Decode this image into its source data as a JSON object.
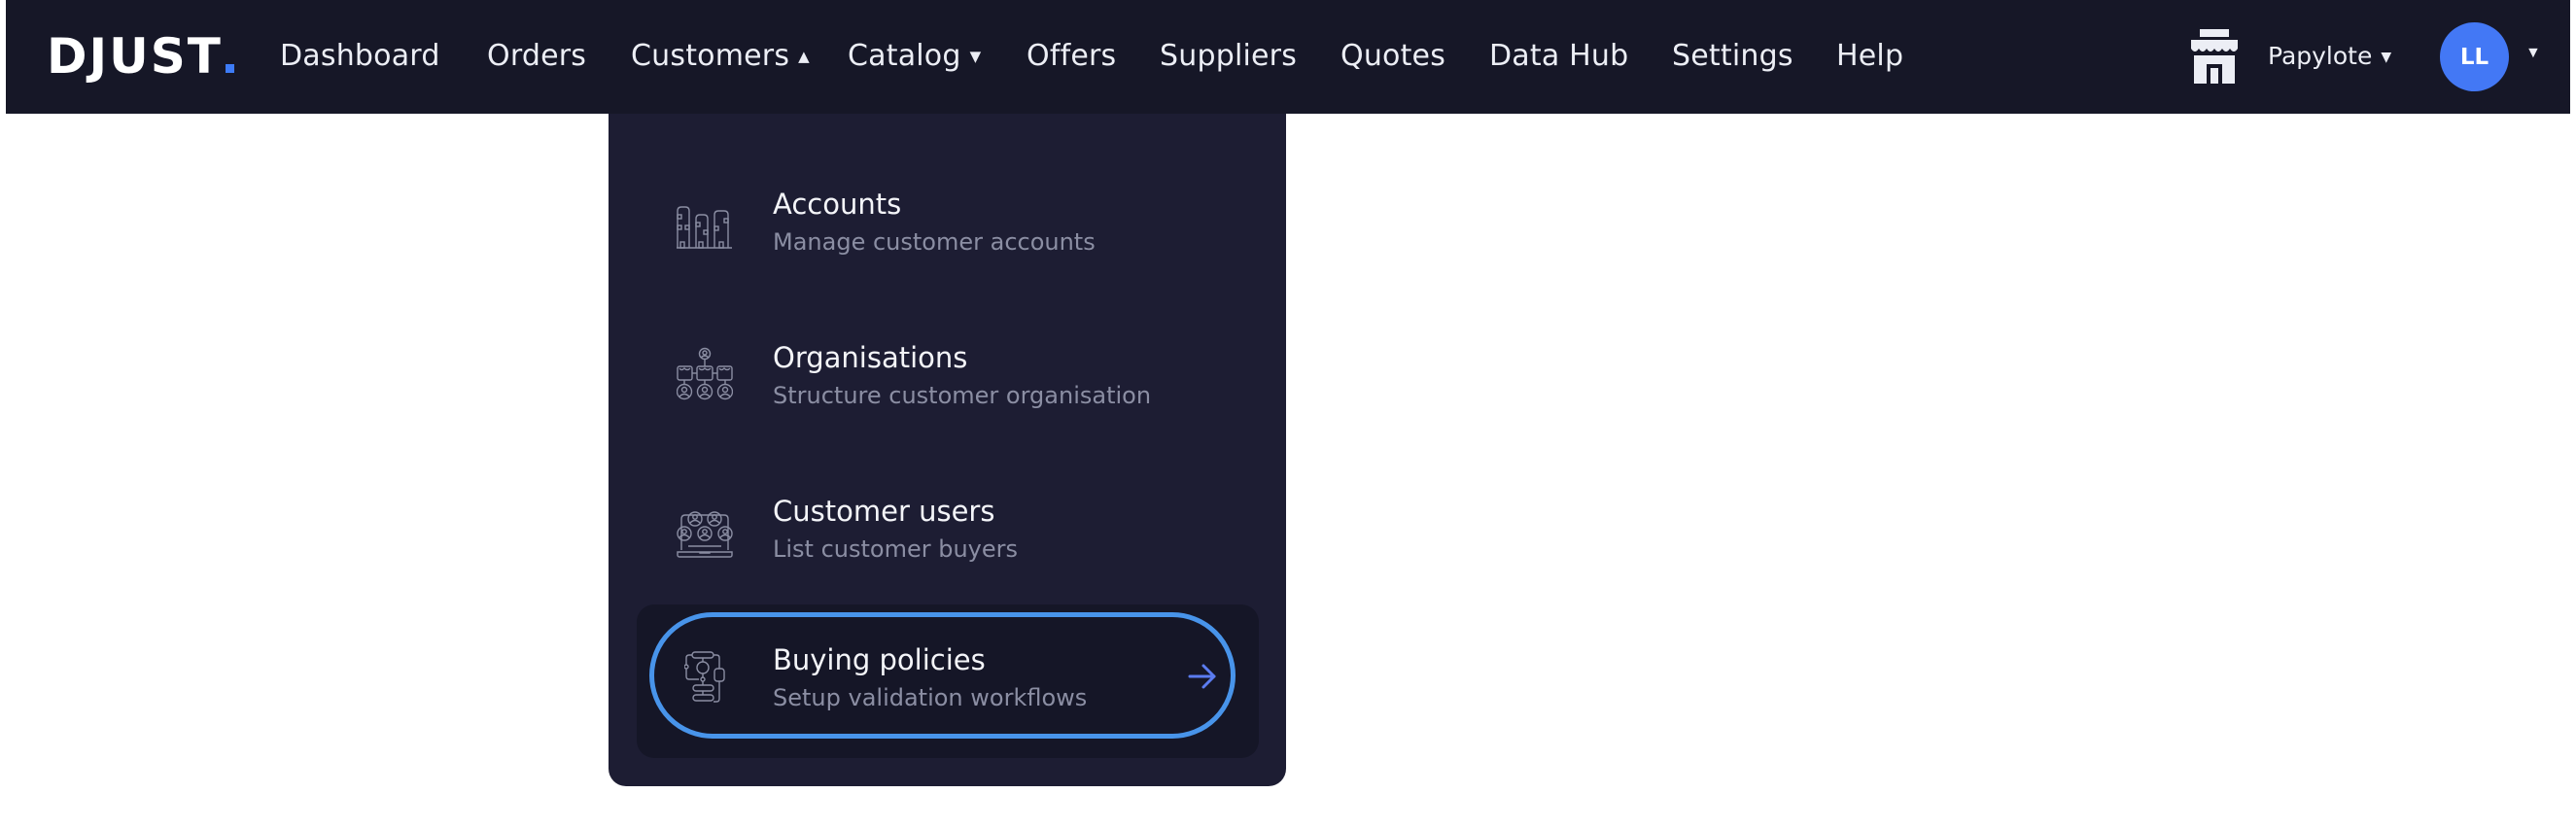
{
  "brand": {
    "logo_text": "DJUST",
    "accent_color": "#3d7bf7"
  },
  "nav": {
    "items": [
      {
        "label": "Dashboard",
        "has_dropdown": false
      },
      {
        "label": "Orders",
        "has_dropdown": false
      },
      {
        "label": "Customers",
        "has_dropdown": true,
        "expanded": true,
        "caret": "▲"
      },
      {
        "label": "Catalog",
        "has_dropdown": true,
        "expanded": false,
        "caret": "▼"
      },
      {
        "label": "Offers",
        "has_dropdown": false
      },
      {
        "label": "Suppliers",
        "has_dropdown": false
      },
      {
        "label": "Quotes",
        "has_dropdown": false
      },
      {
        "label": "Data Hub",
        "has_dropdown": false
      },
      {
        "label": "Settings",
        "has_dropdown": false
      },
      {
        "label": "Help",
        "has_dropdown": false
      }
    ]
  },
  "tenant": {
    "name": "Papylote",
    "icon": "store-icon",
    "caret": "▼"
  },
  "user": {
    "initials": "LL",
    "avatar_color": "#4378f5",
    "caret": "▼"
  },
  "customers_menu": {
    "items": [
      {
        "title": "Accounts",
        "subtitle": "Manage customer accounts",
        "icon": "buildings-icon"
      },
      {
        "title": "Organisations",
        "subtitle": "Structure customer organisation",
        "icon": "org-chart-icon"
      },
      {
        "title": "Customer users",
        "subtitle": "List customer buyers",
        "icon": "users-laptop-icon"
      },
      {
        "title": "Buying policies",
        "subtitle": "Setup validation workflows",
        "icon": "workflow-icon",
        "highlighted": true
      }
    ],
    "focus_color": "#4894ea",
    "arrow_color": "#5b7cf0"
  }
}
